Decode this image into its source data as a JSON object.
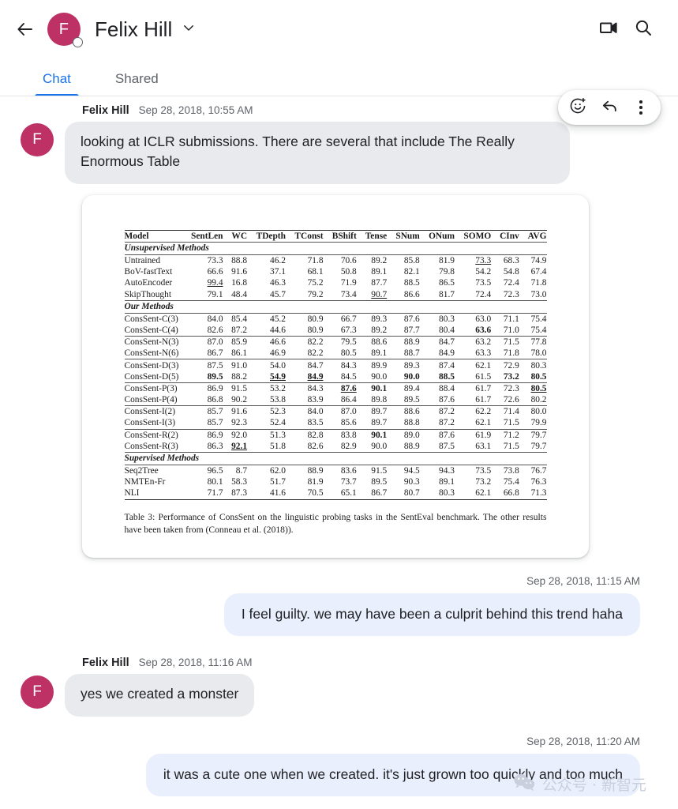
{
  "header": {
    "back_icon": "arrow-left-icon",
    "avatar_initial": "F",
    "avatar_color": "#bd3165",
    "title": "Felix Hill",
    "dropdown_icon": "chevron-down-icon",
    "video_icon": "video-camera-icon",
    "search_icon": "search-icon"
  },
  "tabs": [
    {
      "label": "Chat",
      "active": true
    },
    {
      "label": "Shared",
      "active": false
    }
  ],
  "accent_color": "#1a73e8",
  "hover_actions": [
    {
      "name": "add-reaction-icon",
      "label": "Add reaction"
    },
    {
      "name": "reply-icon",
      "label": "Reply"
    },
    {
      "name": "more-options-icon",
      "label": "More options"
    }
  ],
  "messages": [
    {
      "id": "m1",
      "direction": "incoming",
      "sender": "Felix Hill",
      "timestamp": "Sep 28, 2018, 10:55 AM",
      "avatar_initial": "F",
      "text": "looking at ICLR submissions. There are several that include The Really Enormous Table",
      "has_attachment": true
    },
    {
      "id": "m2",
      "direction": "outgoing",
      "timestamp": "Sep 28, 2018, 11:15 AM",
      "text": "I feel guilty. we may have been a culprit behind this trend haha"
    },
    {
      "id": "m3",
      "direction": "incoming",
      "sender": "Felix Hill",
      "timestamp": "Sep 28, 2018, 11:16 AM",
      "avatar_initial": "F",
      "text": "yes we created a monster"
    },
    {
      "id": "m4",
      "direction": "outgoing",
      "timestamp": "Sep 28, 2018, 11:20 AM",
      "text": "it was a cute one when we created. it's just grown too quickly and too much"
    }
  ],
  "attachment": {
    "caption": "Table 3: Performance of ConsSent on the linguistic probing tasks in the SentEval benchmark. The other results have been taken from (Conneau et al. (2018)).",
    "columns": [
      "Model",
      "SentLen",
      "WC",
      "TDepth",
      "TConst",
      "BShift",
      "Tense",
      "SNum",
      "ONum",
      "SOMO",
      "CInv",
      "AVG"
    ],
    "sections": [
      {
        "title": "Unsupervised Methods",
        "rows": [
          {
            "model": "Untrained",
            "values": [
              "73.3",
              "88.8",
              "46.2",
              "71.8",
              "70.6",
              "89.2",
              "85.8",
              "81.9",
              "73.3",
              "68.3",
              "74.9"
            ],
            "styles": [
              "",
              "",
              "",
              "",
              "",
              "",
              "",
              "",
              "u",
              "",
              ""
            ]
          },
          {
            "model": "BoV-fastText",
            "values": [
              "66.6",
              "91.6",
              "37.1",
              "68.1",
              "50.8",
              "89.1",
              "82.1",
              "79.8",
              "54.2",
              "54.8",
              "67.4"
            ],
            "styles": [
              "",
              "",
              "",
              "",
              "",
              "",
              "",
              "",
              "",
              "",
              ""
            ]
          },
          {
            "model": "AutoEncoder",
            "values": [
              "99.4",
              "16.8",
              "46.3",
              "75.2",
              "71.9",
              "87.7",
              "88.5",
              "86.5",
              "73.5",
              "72.4",
              "71.8"
            ],
            "styles": [
              "u",
              "",
              "",
              "",
              "",
              "",
              "",
              "",
              "",
              "",
              ""
            ]
          },
          {
            "model": "SkipThought",
            "values": [
              "79.1",
              "48.4",
              "45.7",
              "79.2",
              "73.4",
              "90.7",
              "86.6",
              "81.7",
              "72.4",
              "72.3",
              "73.0"
            ],
            "styles": [
              "",
              "",
              "",
              "",
              "",
              "u",
              "",
              "",
              "",
              "",
              ""
            ]
          }
        ]
      },
      {
        "title": "Our Methods",
        "groups": [
          [
            {
              "model": "ConsSent-C(3)",
              "values": [
                "84.0",
                "85.4",
                "45.2",
                "80.9",
                "66.7",
                "89.3",
                "87.6",
                "80.3",
                "63.0",
                "71.1",
                "75.4"
              ],
              "styles": [
                "",
                "",
                "",
                "",
                "",
                "",
                "",
                "",
                "",
                "",
                ""
              ]
            },
            {
              "model": "ConsSent-C(4)",
              "values": [
                "82.6",
                "87.2",
                "44.6",
                "80.9",
                "67.3",
                "89.2",
                "87.7",
                "80.4",
                "63.6",
                "71.0",
                "75.4"
              ],
              "styles": [
                "",
                "",
                "",
                "",
                "",
                "",
                "",
                "",
                "b",
                "",
                ""
              ]
            }
          ],
          [
            {
              "model": "ConsSent-N(3)",
              "values": [
                "87.0",
                "85.9",
                "46.6",
                "82.2",
                "79.5",
                "88.6",
                "88.9",
                "84.7",
                "63.2",
                "71.5",
                "77.8"
              ],
              "styles": [
                "",
                "",
                "",
                "",
                "",
                "",
                "",
                "",
                "",
                "",
                ""
              ]
            },
            {
              "model": "ConsSent-N(6)",
              "values": [
                "86.7",
                "86.1",
                "46.9",
                "82.2",
                "80.5",
                "89.1",
                "88.7",
                "84.9",
                "63.3",
                "71.8",
                "78.0"
              ],
              "styles": [
                "",
                "",
                "",
                "",
                "",
                "",
                "",
                "",
                "",
                "",
                ""
              ]
            }
          ],
          [
            {
              "model": "ConsSent-D(3)",
              "values": [
                "87.5",
                "91.0",
                "54.0",
                "84.7",
                "84.3",
                "89.9",
                "89.3",
                "87.4",
                "62.1",
                "72.9",
                "80.3"
              ],
              "styles": [
                "",
                "",
                "",
                "",
                "",
                "",
                "",
                "",
                "",
                "",
                ""
              ]
            },
            {
              "model": "ConsSent-D(5)",
              "values": [
                "89.5",
                "88.2",
                "54.9",
                "84.9",
                "84.5",
                "90.0",
                "90.0",
                "88.5",
                "61.5",
                "73.2",
                "80.5"
              ],
              "styles": [
                "b",
                "",
                "bu",
                "bu",
                "",
                "",
                "b",
                "b",
                "",
                "b",
                "b"
              ]
            }
          ],
          [
            {
              "model": "ConsSent-P(3)",
              "values": [
                "86.9",
                "91.5",
                "53.2",
                "84.3",
                "87.6",
                "90.1",
                "89.4",
                "88.4",
                "61.7",
                "72.3",
                "80.5"
              ],
              "styles": [
                "",
                "",
                "",
                "",
                "bu",
                "b",
                "",
                "",
                "",
                "",
                "bu"
              ]
            },
            {
              "model": "ConsSent-P(4)",
              "values": [
                "86.8",
                "90.2",
                "53.8",
                "83.9",
                "86.4",
                "89.8",
                "89.5",
                "87.6",
                "61.7",
                "72.6",
                "80.2"
              ],
              "styles": [
                "",
                "",
                "",
                "",
                "",
                "",
                "",
                "",
                "",
                "",
                ""
              ]
            }
          ],
          [
            {
              "model": "ConsSent-I(2)",
              "values": [
                "85.7",
                "91.6",
                "52.3",
                "84.0",
                "87.0",
                "89.7",
                "88.6",
                "87.2",
                "62.2",
                "71.4",
                "80.0"
              ],
              "styles": [
                "",
                "",
                "",
                "",
                "",
                "",
                "",
                "",
                "",
                "",
                ""
              ]
            },
            {
              "model": "ConsSent-I(3)",
              "values": [
                "85.7",
                "92.3",
                "52.4",
                "83.5",
                "85.6",
                "89.7",
                "88.8",
                "87.2",
                "62.1",
                "71.5",
                "79.9"
              ],
              "styles": [
                "",
                "",
                "",
                "",
                "",
                "",
                "",
                "",
                "",
                "",
                ""
              ]
            }
          ],
          [
            {
              "model": "ConsSent-R(2)",
              "values": [
                "86.9",
                "92.0",
                "51.3",
                "82.8",
                "83.8",
                "90.1",
                "89.0",
                "87.6",
                "61.9",
                "71.2",
                "79.7"
              ],
              "styles": [
                "",
                "",
                "",
                "",
                "",
                "b",
                "",
                "",
                "",
                "",
                ""
              ]
            },
            {
              "model": "ConsSent-R(3)",
              "values": [
                "86.3",
                "92.1",
                "51.8",
                "82.6",
                "82.9",
                "90.0",
                "88.9",
                "87.5",
                "63.1",
                "71.5",
                "79.7"
              ],
              "styles": [
                "",
                "bu",
                "",
                "",
                "",
                "",
                "",
                "",
                "",
                "",
                ""
              ]
            }
          ]
        ]
      },
      {
        "title": "Supervised Methods",
        "rows": [
          {
            "model": "Seq2Tree",
            "values": [
              "96.5",
              "8.7",
              "62.0",
              "88.9",
              "83.6",
              "91.5",
              "94.5",
              "94.3",
              "73.5",
              "73.8",
              "76.7"
            ],
            "styles": [
              "",
              "",
              "",
              "",
              "",
              "",
              "",
              "",
              "",
              "",
              ""
            ]
          },
          {
            "model": "NMTEn-Fr",
            "values": [
              "80.1",
              "58.3",
              "51.7",
              "81.9",
              "73.7",
              "89.5",
              "90.3",
              "89.1",
              "73.2",
              "75.4",
              "76.3"
            ],
            "styles": [
              "",
              "",
              "",
              "",
              "",
              "",
              "",
              "",
              "",
              "",
              ""
            ]
          },
          {
            "model": "NLI",
            "values": [
              "71.7",
              "87.3",
              "41.6",
              "70.5",
              "65.1",
              "86.7",
              "80.7",
              "80.3",
              "62.1",
              "66.8",
              "71.3"
            ],
            "styles": [
              "",
              "",
              "",
              "",
              "",
              "",
              "",
              "",
              "",
              "",
              ""
            ]
          }
        ]
      }
    ]
  },
  "watermark": {
    "icon": "wechat-logo-icon",
    "text": "公众号 · 新智元"
  }
}
